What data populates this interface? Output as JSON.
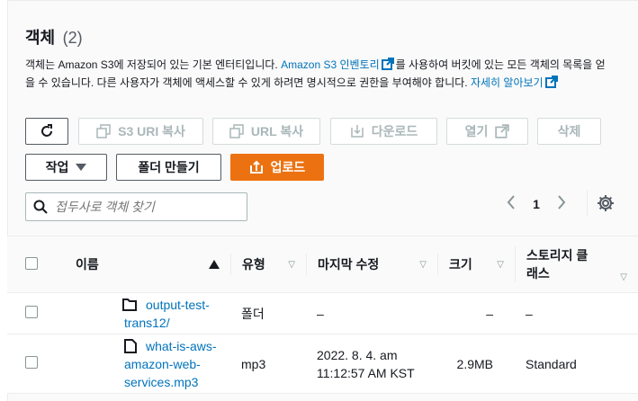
{
  "header": {
    "title": "객체",
    "count": "(2)"
  },
  "description": {
    "part1": "객체는 Amazon S3에 저장되어 있는 기본 엔터티입니다. ",
    "inventory_link": "Amazon S3 인벤토리",
    "part2": "를 사용하여 버킷에 있는 모든 객체의 목록을 얻을 수 있습니다. 다른 사용자가 객체에 액세스할 수 있게 하려면 명시적으로 권한을 부여해야 합니다. ",
    "learn_more_link": "자세히 알아보기"
  },
  "toolbar": {
    "copy_s3_uri": "S3 URI 복사",
    "copy_url": "URL 복사",
    "download": "다운로드",
    "open": "열기",
    "delete": "삭제",
    "actions": "작업",
    "create_folder": "폴더 만들기",
    "upload": "업로드"
  },
  "search": {
    "placeholder": "접두사로 객체 찾기"
  },
  "pagination": {
    "current_page": "1"
  },
  "table": {
    "columns": [
      "이름",
      "유형",
      "마지막 수정",
      "크기",
      "스토리지 클래스"
    ],
    "rows": [
      {
        "name_line1": "output-test-",
        "name_line2": "trans12/",
        "icon": "folder-icon",
        "type": "폴더",
        "modified": "–",
        "size": "–",
        "storage": "–"
      },
      {
        "name_line1": "what-is-aws-",
        "name_line2": "amazon-web-",
        "name_line3": "services.mp3",
        "icon": "file-icon",
        "type": "mp3",
        "modified_line1": "2022. 8. 4. am",
        "modified_line2": "11:12:57 AM KST",
        "size": "2.9MB",
        "storage": "Standard"
      }
    ]
  },
  "colors": {
    "accent": "#ec7211",
    "link": "#0073bb"
  }
}
